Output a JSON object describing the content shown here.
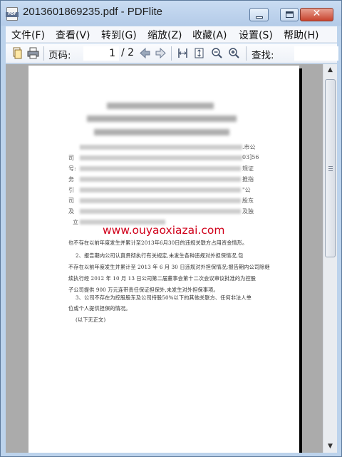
{
  "window": {
    "title": "2013601869235.pdf - PDFlite",
    "app_icon_label": "PDF",
    "minimize_glyph": "",
    "maximize_glyph": "",
    "close_glyph": "✕"
  },
  "menu": {
    "items": [
      {
        "label": "文件(F)"
      },
      {
        "label": "查看(V)"
      },
      {
        "label": "转到(G)"
      },
      {
        "label": "缩放(Z)"
      },
      {
        "label": "收藏(A)"
      },
      {
        "label": "设置(S)"
      },
      {
        "label": "帮助(H)"
      }
    ]
  },
  "toolbar": {
    "page_label": "页码:",
    "current_page": "1",
    "total_pages": "/ 2",
    "search_label": "查找:",
    "search_value": "",
    "icons": [
      "open-icon",
      "print-icon",
      "prev-page-icon",
      "next-page-icon",
      "fit-width-icon",
      "fit-page-icon",
      "zoom-out-icon",
      "zoom-in-icon"
    ]
  },
  "document": {
    "edge_chars_left": [
      "司",
      "号:",
      "务",
      "引",
      "司",
      "及",
      "立"
    ],
    "edge_chars_right": [
      ".市公",
      "03]56",
      "规证",
      "推指",
      "\"公",
      "股东",
      "及独"
    ],
    "visible_lines": [
      "也不存在以前年度发生并累计至2013年6月30日的违规关联方占用资金情形。",
      "2、报告期内公司认真贯彻执行有关规定,未发生各种违规对外担保情况,包",
      "不存在以前年度发生并累计至 2013 年 6 月 30 日违规对外担保情况;报告期内公司除继",
      "续执行经 2012 年 10 月 13 日公司第二届董事会第十二次会议审议批准的为控股",
      "子公司提供 900 万元连带责任保证担保外,未发生对外担保事项。",
      "3、公司不存在为控股股东及公司持股50%以下的其他关联方、任何非法人单",
      "位或个人提供担保的情况。",
      "(以下无正文)"
    ],
    "watermark": "www.ouyaoxiazai.com"
  },
  "scrollbar": {
    "up_glyph": "▲",
    "down_glyph": "▼"
  }
}
